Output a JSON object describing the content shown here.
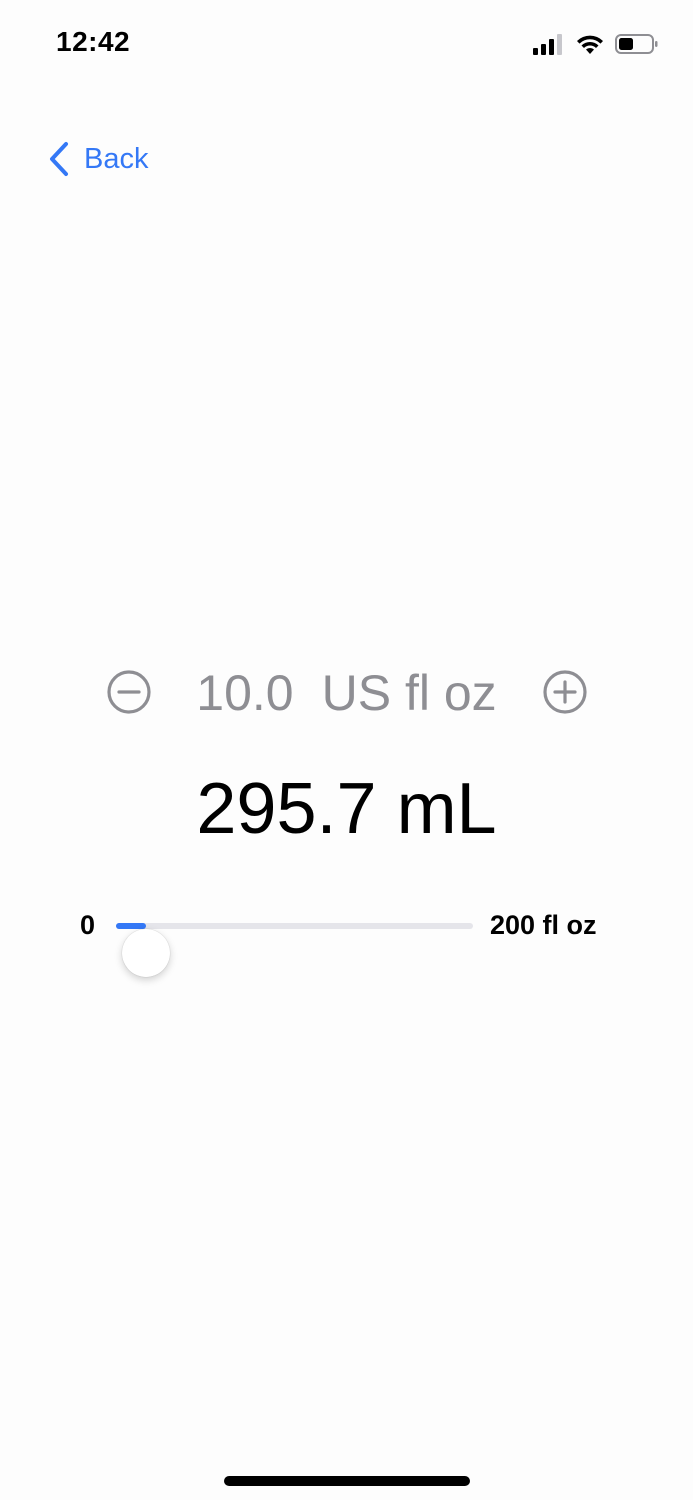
{
  "status_bar": {
    "time": "12:42",
    "icons": [
      "cellular-signal-icon",
      "wifi-icon",
      "battery-icon"
    ],
    "battery_level": 0.45
  },
  "nav": {
    "back_label": "Back",
    "back_icon": "chevron-left-icon"
  },
  "stepper": {
    "value": "10.0",
    "unit": "US fl oz",
    "minus_icon": "minus-circle-icon",
    "plus_icon": "plus-circle-icon"
  },
  "converted": {
    "text": "295.7 mL"
  },
  "slider": {
    "min_label": "0",
    "max_label": "200 fl oz",
    "min": 0,
    "max": 200,
    "value": 10.0
  },
  "colors": {
    "accent": "#3478f6",
    "secondary_text": "#8e8e93",
    "track": "#e5e5ea"
  }
}
